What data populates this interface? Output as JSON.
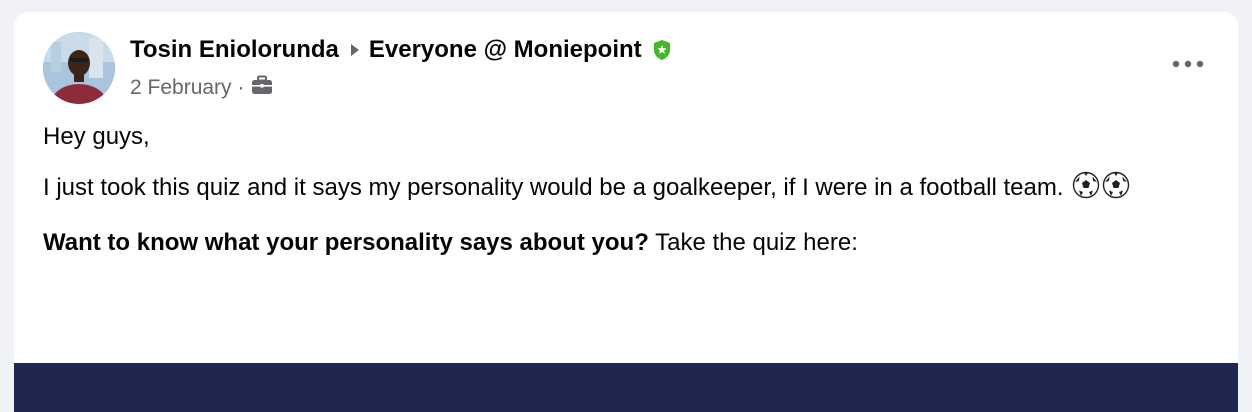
{
  "post": {
    "author": "Tosin Eniolorunda",
    "audience": "Everyone @ Moniepoint",
    "date": "2 February",
    "separator": "·",
    "greeting": "Hey guys,",
    "body_line": "I just took this quiz and it says my personality would be a goalkeeper, if I were in a football team.",
    "cta_bold": "Want to know what your personality says about you?",
    "cta_rest": " Take the quiz here:"
  },
  "icons": {
    "arrow": "caret-right-icon",
    "admin": "shield-star-icon",
    "audience": "briefcase-icon",
    "more": "more-horizontal-icon",
    "emoji": "soccer-ball-icon"
  },
  "colors": {
    "shield": "#42b72a",
    "secondary_text": "#65676b",
    "banner": "#1f2650"
  }
}
